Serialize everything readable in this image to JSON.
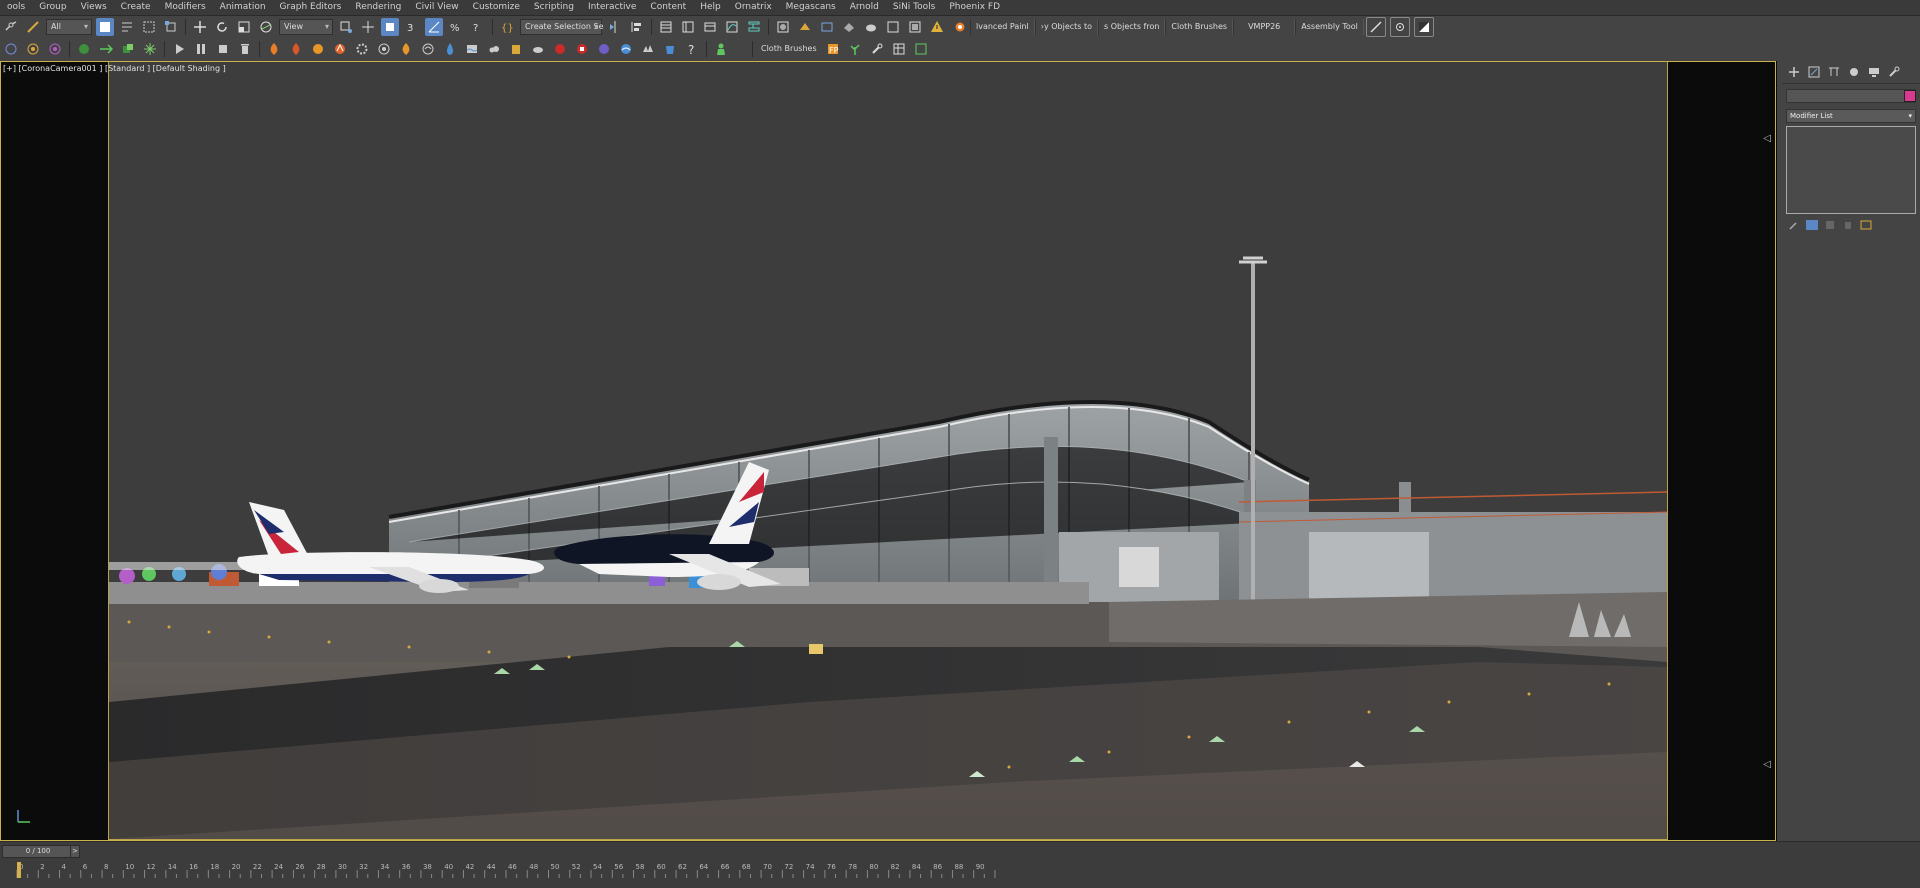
{
  "menu": [
    "ools",
    "Group",
    "Views",
    "Create",
    "Modifiers",
    "Animation",
    "Graph Editors",
    "Rendering",
    "Civil View",
    "Customize",
    "Scripting",
    "Interactive",
    "Content",
    "Help",
    "Ornatrix",
    "Megascans",
    "Arnold",
    "SiNi Tools",
    "Phoenix FD"
  ],
  "toolbar": {
    "selection_filter": "All",
    "ref_coord": "View",
    "named_selection": "Create Selection Se",
    "labels": [
      "lvanced Painl",
      "›y Objects to",
      "s Objects fron",
      "Cloth Brushes",
      "VMPP26",
      "Assembly Tool"
    ],
    "cloth_brushes_2": "Cloth Brushes"
  },
  "viewport": {
    "label": "[+] [CoronaCamera001 ] [Standard ] [Default Shading ]"
  },
  "command_panel": {
    "modifier_list": "Modifier List",
    "swatch_color": "#d63b8f"
  },
  "timeline": {
    "frame_counter": "0 / 100",
    "ticks": [
      0,
      2,
      4,
      6,
      8,
      10,
      12,
      14,
      16,
      18,
      20,
      22,
      24,
      26,
      28,
      30,
      32,
      34,
      36,
      38,
      40,
      42,
      44,
      46,
      48,
      50,
      52,
      54,
      56,
      58,
      60,
      62,
      64,
      66,
      68,
      70,
      72,
      74,
      76,
      78,
      80,
      82,
      84,
      86,
      88,
      90
    ],
    "current_frame": 0
  }
}
